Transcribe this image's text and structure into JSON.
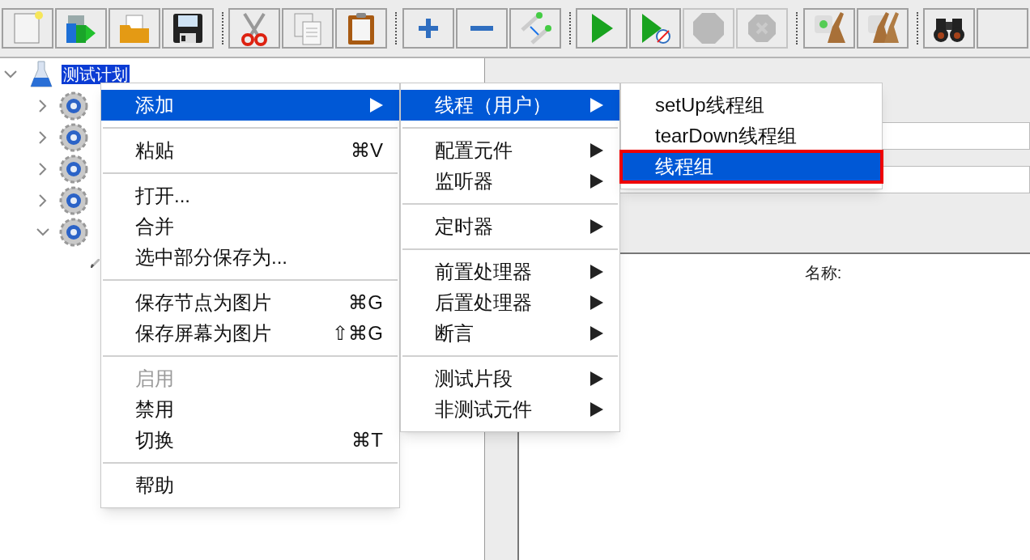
{
  "toolbar": {
    "groups": [
      [
        {
          "disabled": false
        },
        {
          "disabled": false
        },
        {
          "disabled": false
        },
        {
          "disabled": false
        }
      ],
      [
        {
          "disabled": false
        },
        {
          "disabled": false
        },
        {
          "disabled": false
        }
      ],
      [
        {
          "disabled": false
        },
        {
          "disabled": false
        },
        {
          "disabled": false
        }
      ],
      [
        {
          "disabled": false
        },
        {
          "disabled": false
        },
        {
          "disabled": true
        },
        {
          "disabled": true
        }
      ],
      [
        {
          "disabled": false
        },
        {
          "disabled": false
        }
      ],
      [
        {
          "disabled": false
        },
        {
          "disabled": false
        }
      ]
    ]
  },
  "tree": {
    "items": [
      {
        "label": "测试计划",
        "selected": true,
        "expanded": true,
        "kind": "plan",
        "children": [
          {
            "expanded": false,
            "kind": "group"
          },
          {
            "expanded": false,
            "kind": "group"
          },
          {
            "expanded": false,
            "kind": "group"
          },
          {
            "expanded": false,
            "kind": "group"
          },
          {
            "expanded": true,
            "kind": "group",
            "children": [
              {
                "kind": "sampler"
              }
            ]
          }
        ]
      }
    ]
  },
  "panel": {
    "table_header": "名称:"
  },
  "context_menu": {
    "items": [
      {
        "kind": "item",
        "label": "添加",
        "selected": true,
        "submenu": true
      },
      {
        "kind": "separator"
      },
      {
        "kind": "item",
        "label": "粘贴",
        "shortcut": "⌘V",
        "selected": false,
        "disabled": false
      },
      {
        "kind": "separator"
      },
      {
        "kind": "item",
        "label": "打开...",
        "selected": false,
        "disabled": false
      },
      {
        "kind": "item",
        "label": "合并",
        "selected": false,
        "disabled": false
      },
      {
        "kind": "item",
        "label": "选中部分保存为...",
        "selected": false,
        "disabled": false
      },
      {
        "kind": "separator"
      },
      {
        "kind": "item",
        "label": "保存节点为图片",
        "shortcut": "⌘G",
        "selected": false,
        "disabled": false
      },
      {
        "kind": "item",
        "label": "保存屏幕为图片",
        "shortcut": "⇧⌘G",
        "selected": false,
        "disabled": false
      },
      {
        "kind": "separator"
      },
      {
        "kind": "item",
        "label": "启用",
        "selected": false,
        "disabled": true
      },
      {
        "kind": "item",
        "label": "禁用",
        "selected": false,
        "disabled": false
      },
      {
        "kind": "item",
        "label": "切换",
        "shortcut": "⌘T",
        "selected": false,
        "disabled": false
      },
      {
        "kind": "separator"
      },
      {
        "kind": "item",
        "label": "帮助",
        "selected": false,
        "disabled": false
      }
    ]
  },
  "add_submenu": {
    "items": [
      {
        "kind": "item",
        "label": "线程（用户）",
        "selected": true,
        "submenu": true
      },
      {
        "kind": "separator"
      },
      {
        "kind": "item",
        "label": "配置元件",
        "selected": false,
        "submenu": true
      },
      {
        "kind": "item",
        "label": "监听器",
        "selected": false,
        "submenu": true
      },
      {
        "kind": "separator"
      },
      {
        "kind": "item",
        "label": "定时器",
        "selected": false,
        "submenu": true
      },
      {
        "kind": "separator"
      },
      {
        "kind": "item",
        "label": "前置处理器",
        "selected": false,
        "submenu": true
      },
      {
        "kind": "item",
        "label": "后置处理器",
        "selected": false,
        "submenu": true
      },
      {
        "kind": "item",
        "label": "断言",
        "selected": false,
        "submenu": true
      },
      {
        "kind": "separator"
      },
      {
        "kind": "item",
        "label": "测试片段",
        "selected": false,
        "submenu": true
      },
      {
        "kind": "item",
        "label": "非测试元件",
        "selected": false,
        "submenu": true
      }
    ]
  },
  "threads_submenu": {
    "items": [
      {
        "kind": "item",
        "label": "setUp线程组",
        "selected": false,
        "highlighted": false
      },
      {
        "kind": "item",
        "label": "tearDown线程组",
        "selected": false,
        "highlighted": false
      },
      {
        "kind": "item",
        "label": "线程组",
        "selected": true,
        "highlighted": true
      }
    ]
  }
}
